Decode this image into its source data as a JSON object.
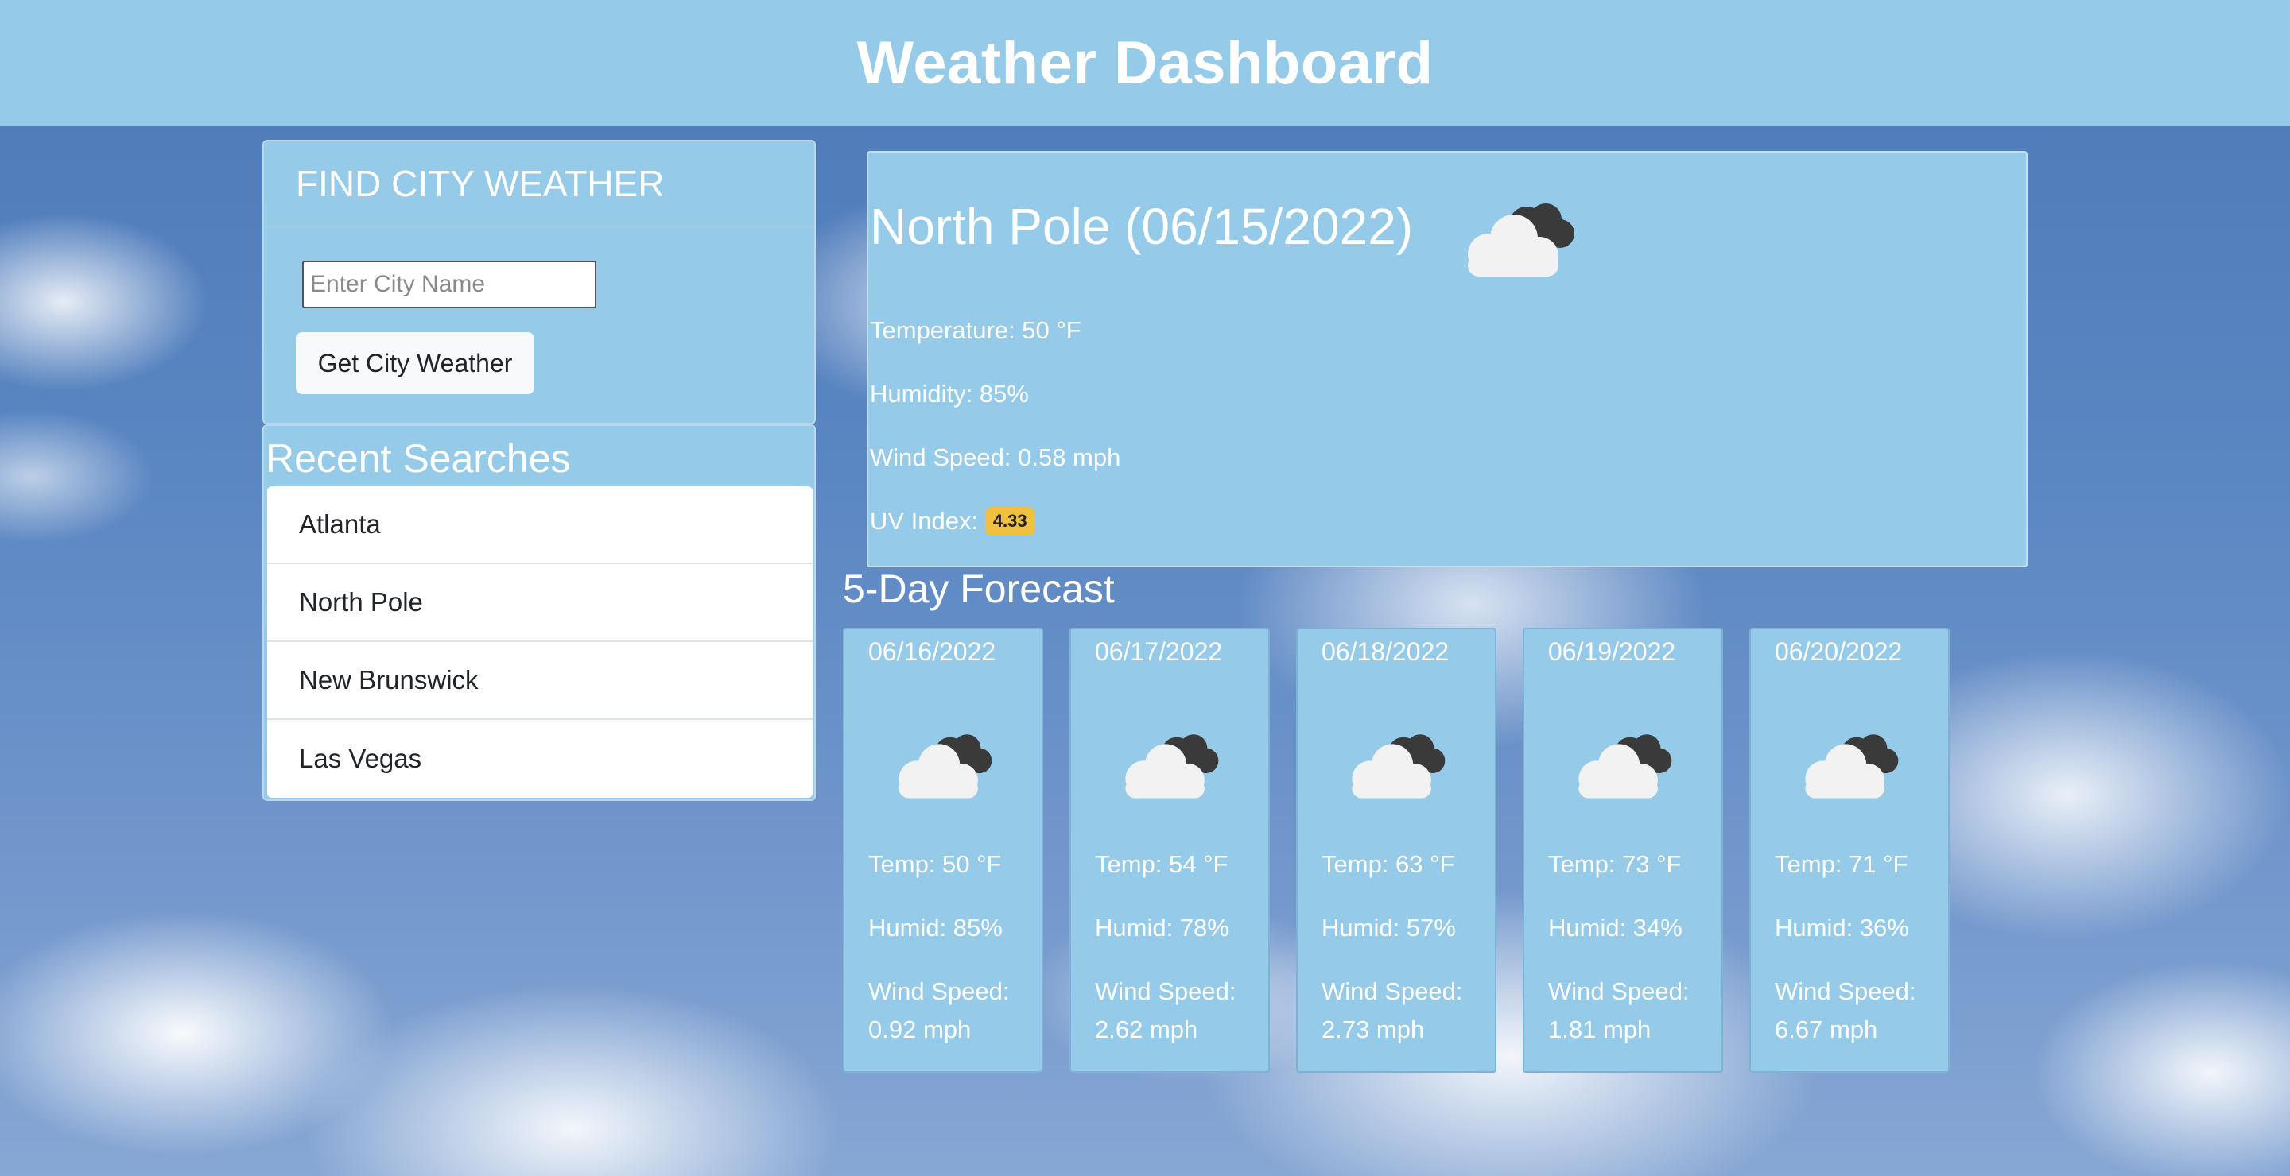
{
  "header": {
    "title": "Weather Dashboard"
  },
  "search": {
    "title": "FIND CITY WEATHER",
    "input_value": "",
    "placeholder": "Enter City Name",
    "button_label": "Get City Weather"
  },
  "recent": {
    "title": "Recent Searches",
    "items": [
      {
        "label": "Atlanta"
      },
      {
        "label": "North Pole"
      },
      {
        "label": "New Brunswick"
      },
      {
        "label": "Las Vegas"
      }
    ]
  },
  "current": {
    "title": "North Pole (06/15/2022)",
    "icon": "partly-cloudy-icon",
    "temperature": "Temperature: 50 °F",
    "humidity": "Humidity: 85%",
    "wind": "Wind Speed: 0.58 mph",
    "uv_label": "UV Index:",
    "uv_value": "4.33",
    "uv_color": "#f0c040"
  },
  "forecast": {
    "title": "5-Day Forecast",
    "days": [
      {
        "date": "06/16/2022",
        "temp": "Temp: 50 °F",
        "humid": "Humid: 85%",
        "wind_label": "Wind Speed:",
        "wind_value": "0.92 mph",
        "icon": "partly-cloudy-icon"
      },
      {
        "date": "06/17/2022",
        "temp": "Temp: 54 °F",
        "humid": "Humid: 78%",
        "wind_label": "Wind Speed:",
        "wind_value": "2.62 mph",
        "icon": "partly-cloudy-icon"
      },
      {
        "date": "06/18/2022",
        "temp": "Temp: 63 °F",
        "humid": "Humid: 57%",
        "wind_label": "Wind Speed:",
        "wind_value": "2.73 mph",
        "icon": "partly-cloudy-icon"
      },
      {
        "date": "06/19/2022",
        "temp": "Temp: 73 °F",
        "humid": "Humid: 34%",
        "wind_label": "Wind Speed:",
        "wind_value": "1.81 mph",
        "icon": "partly-cloudy-icon"
      },
      {
        "date": "06/20/2022",
        "temp": "Temp: 71 °F",
        "humid": "Humid: 36%",
        "wind_label": "Wind Speed:",
        "wind_value": "6.67 mph",
        "icon": "partly-cloudy-icon"
      }
    ]
  },
  "colors": {
    "panel": "#95cbe8",
    "header_bg": "#95cbe8",
    "text": "#ffffff"
  }
}
